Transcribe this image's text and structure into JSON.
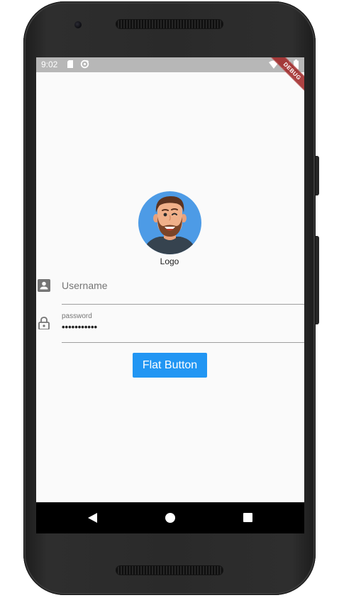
{
  "status_bar": {
    "time": "9:02",
    "icons": [
      "sd-card-icon",
      "sync-icon",
      "wifi-icon",
      "signal-icon",
      "battery-icon"
    ]
  },
  "debug_banner": "DEBUG",
  "header": {
    "logo_label": "Logo",
    "avatar_icon": "avatar-icon"
  },
  "form": {
    "username": {
      "placeholder": "Username",
      "value": "",
      "icon": "account-box-icon"
    },
    "password": {
      "label": "password",
      "value": "•••••••••••",
      "icon": "lock-icon"
    },
    "submit_label": "Flat Button"
  },
  "nav_bar": {
    "icons": [
      "back-icon",
      "home-icon",
      "recents-icon"
    ]
  },
  "colors": {
    "accent": "#2196f3",
    "status_bar": "#b7b7b7",
    "background": "#fafafa",
    "avatar_bg": "#4d9be6",
    "debug_banner": "#a02828"
  }
}
